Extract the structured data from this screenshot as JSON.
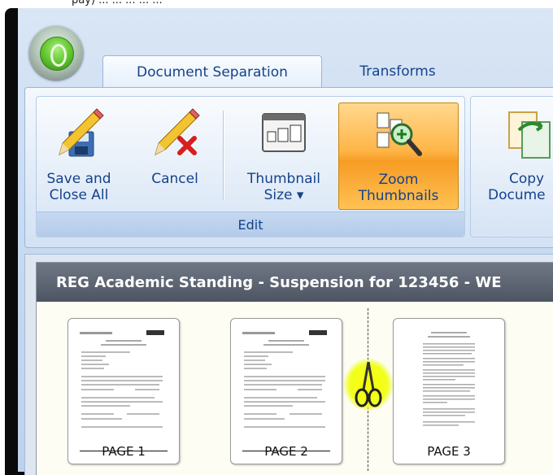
{
  "window": {
    "caption_fragment": "pay) ... ... ... ... ..."
  },
  "tabs": [
    {
      "label": "Document Separation",
      "active": true
    },
    {
      "label": "Transforms",
      "active": false
    }
  ],
  "ribbon": {
    "edit_group": {
      "label": "Edit",
      "buttons": [
        {
          "label_line1": "Save and",
          "label_line2": "Close All",
          "icon": "save-pencil-icon"
        },
        {
          "label_line1": "Cancel",
          "label_line2": "",
          "icon": "cancel-pencil-icon"
        },
        {
          "label_line1": "Thumbnail",
          "label_line2": "Size ▾",
          "icon": "thumbnail-size-icon"
        },
        {
          "label_line1": "Zoom",
          "label_line2": "Thumbnails",
          "icon": "zoom-thumbnails-icon",
          "highlighted": true
        }
      ]
    },
    "second_group": {
      "buttons": [
        {
          "label_line1": "Copy",
          "label_line2": "Docume",
          "icon": "copy-document-icon"
        }
      ]
    }
  },
  "document": {
    "title": "REG Academic Standing - Suspension for 123456 - WE",
    "pages": [
      {
        "label": "PAGE 1"
      },
      {
        "label": "PAGE 2"
      },
      {
        "label": "PAGE 3"
      }
    ],
    "separator": {
      "icon": "scissors-icon",
      "highlight_color": "#f6ff00"
    }
  },
  "colors": {
    "ribbon_text": "#15428b",
    "hot_button": "#ffb547",
    "title_bar": "#5a616e"
  }
}
